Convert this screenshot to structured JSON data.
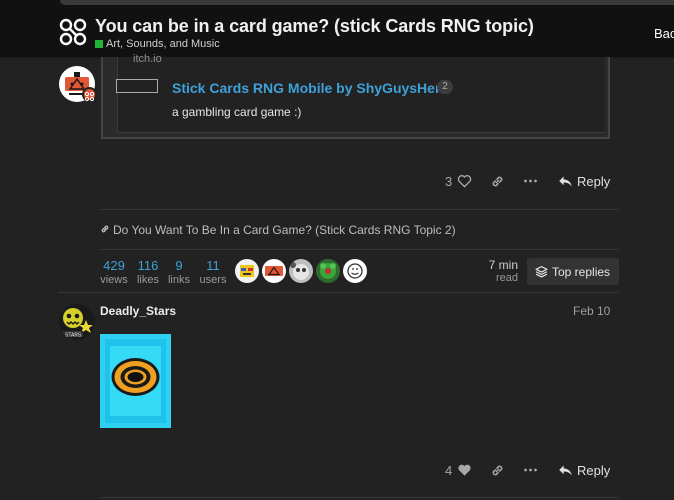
{
  "header": {
    "title": "You can be in a card game? (stick Cards RNG topic)",
    "category": "Art, Sounds, and Music",
    "category_color": "#1db533",
    "back_label": "Bac"
  },
  "first_post": {
    "onebox": {
      "site": "itch.io",
      "title": "Stick Cards RNG Mobile by ShyGuysHere",
      "click_count": "2",
      "description": "a gambling card game :)"
    },
    "likes": "3",
    "reply_label": "Reply"
  },
  "linked_topic": "Do You Want To Be In a Card Game? (Stick Cards RNG Topic 2)",
  "topic_map": {
    "stats": [
      {
        "num": "429",
        "label": "views"
      },
      {
        "num": "116",
        "label": "likes"
      },
      {
        "num": "9",
        "label": "links"
      },
      {
        "num": "11",
        "label": "users"
      }
    ],
    "read_time": "7 min",
    "read_label": "read",
    "top_replies_label": "Top replies"
  },
  "second_post": {
    "username": "Deadly_Stars",
    "date": "Feb 10",
    "likes": "4",
    "reply_label": "Reply"
  },
  "colors": {
    "accent_link": "#3ea1d8",
    "background": "#222222",
    "header": "#111111"
  }
}
